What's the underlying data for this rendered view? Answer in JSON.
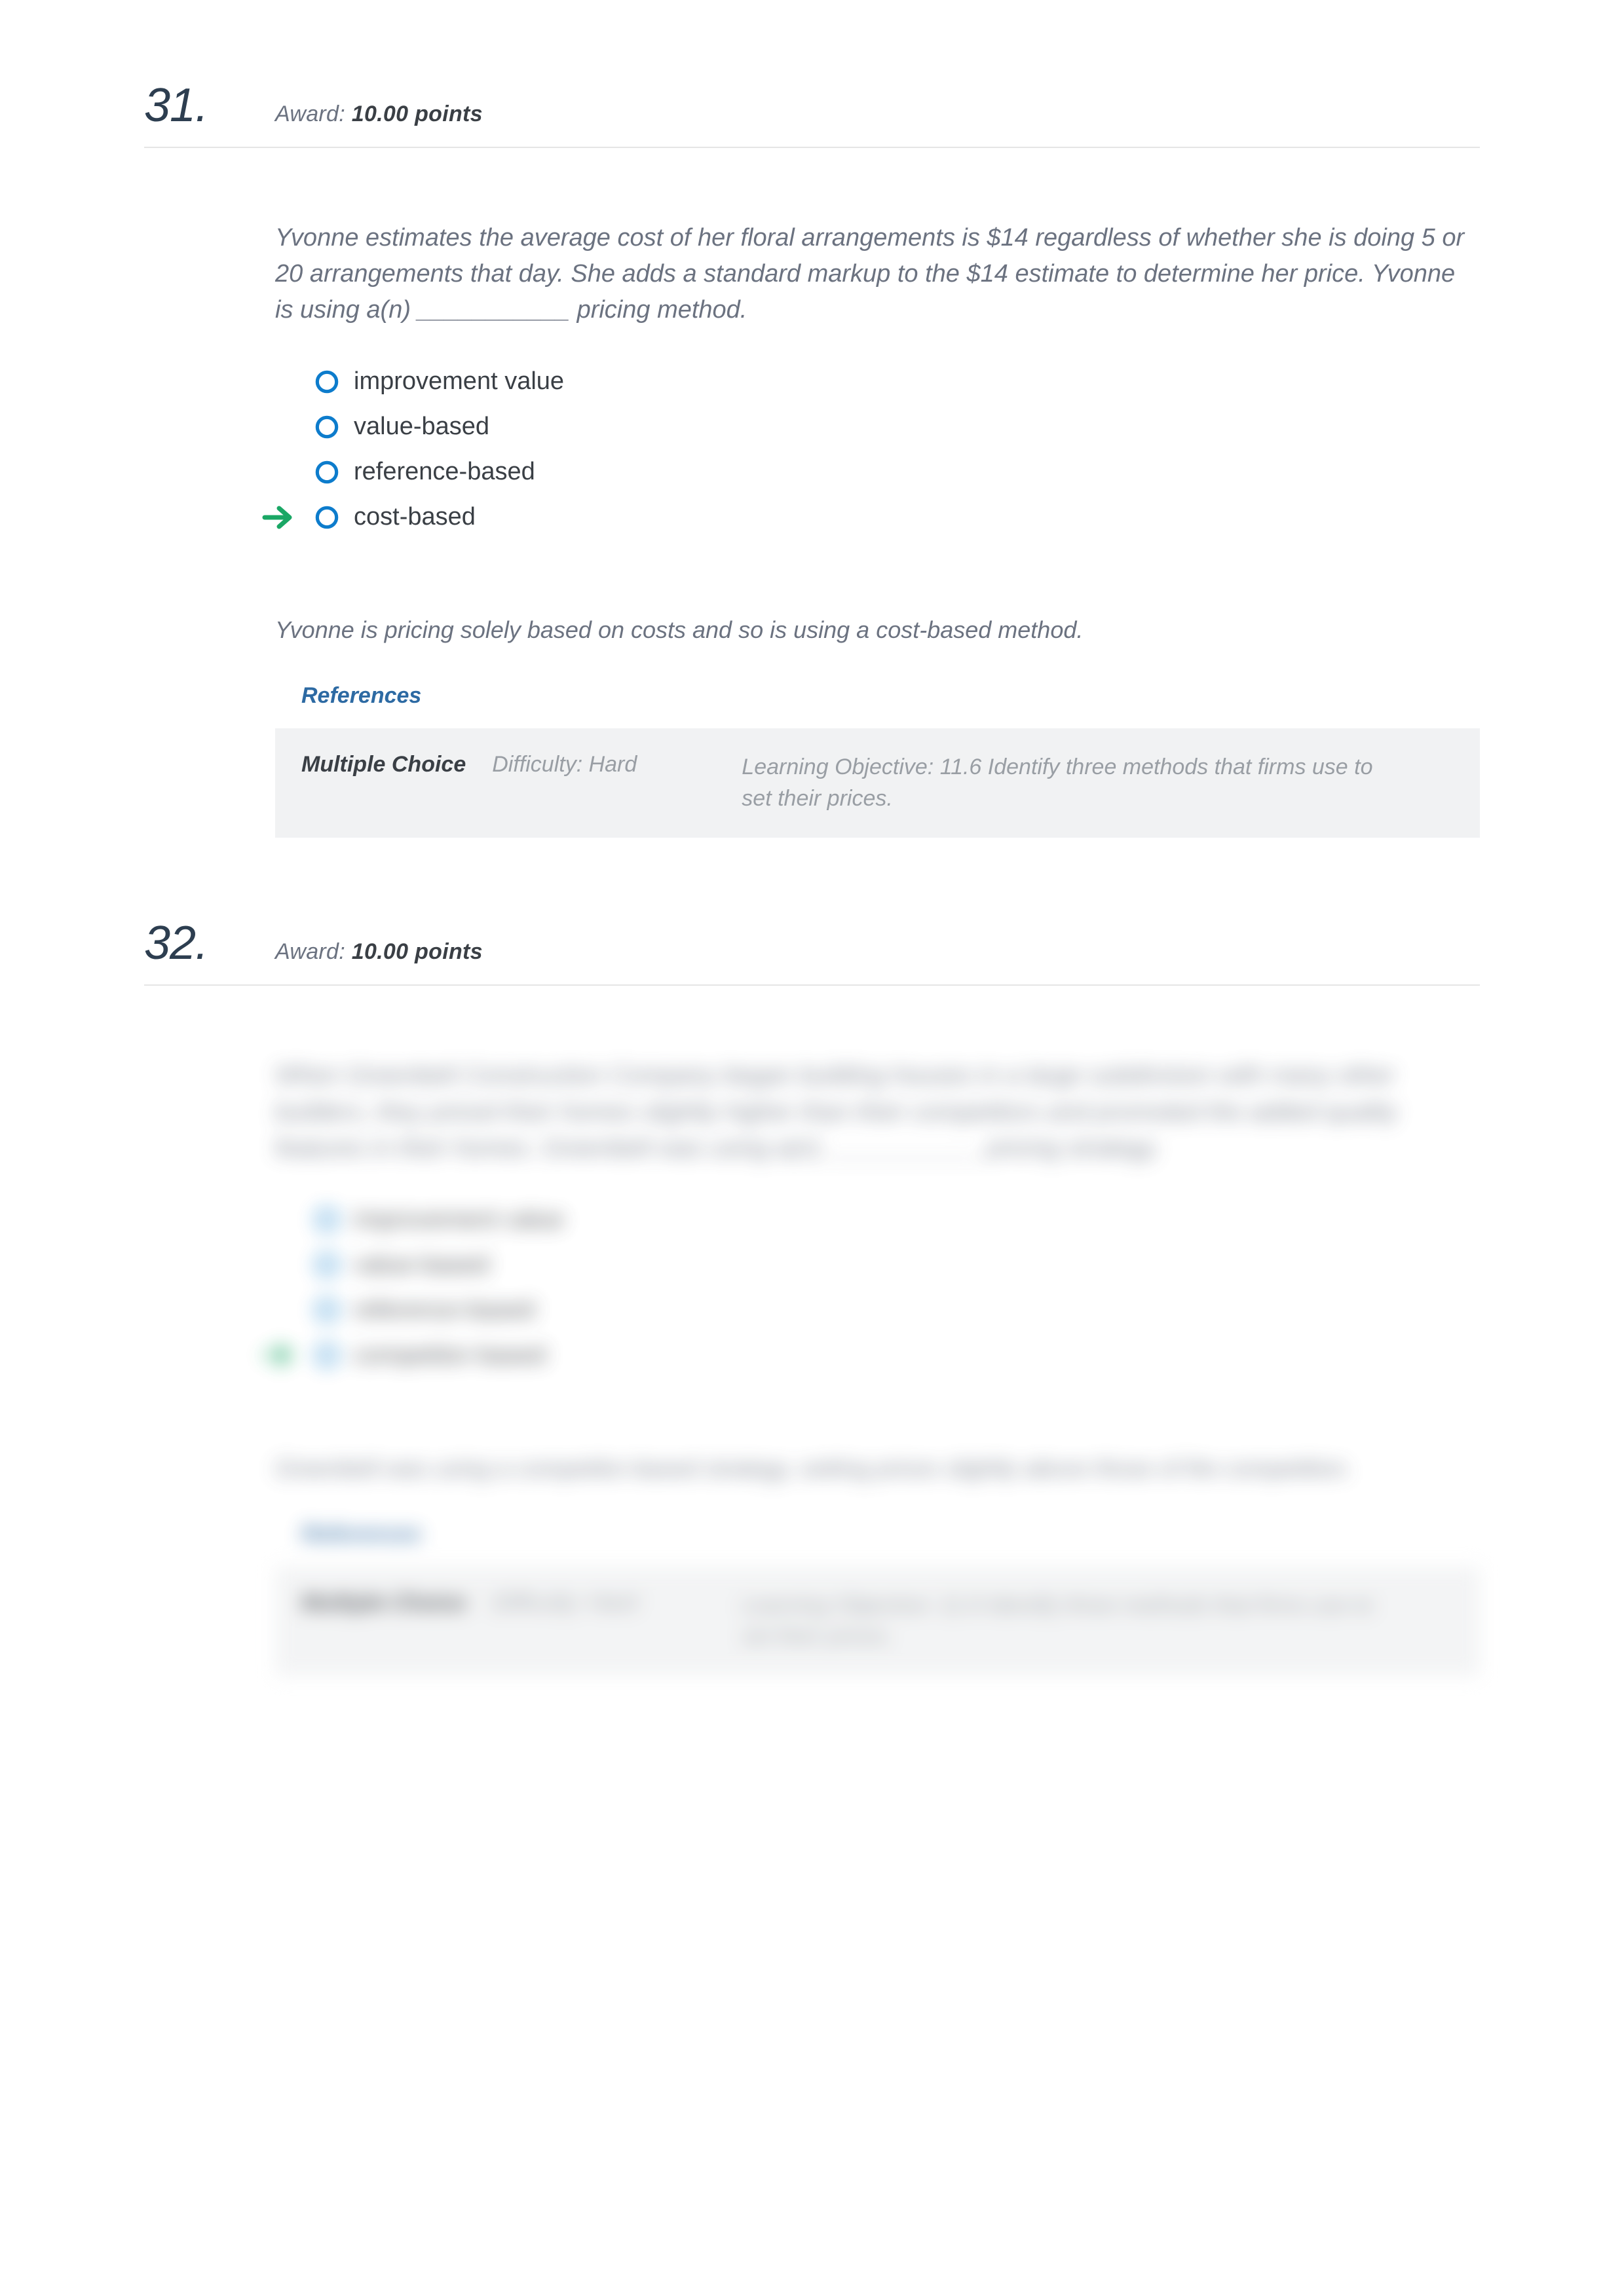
{
  "questions": [
    {
      "number": "31.",
      "award_prefix": "Award: ",
      "award_points": "10.00 points",
      "stem": "Yvonne estimates the average cost of her floral arrangements is $14 regardless of whether she is doing 5 or 20 arrangements that day. She adds a standard markup to the $14 estimate to determine her price. Yvonne is using a(n) ___________ pricing method.",
      "options": [
        {
          "label": "improvement value",
          "correct": false
        },
        {
          "label": "value-based",
          "correct": false
        },
        {
          "label": "reference-based",
          "correct": false
        },
        {
          "label": "cost-based",
          "correct": true
        }
      ],
      "explanation": "Yvonne is pricing solely based on costs and so is using a cost-based method.",
      "references_label": "References",
      "meta": {
        "type": "Multiple Choice",
        "difficulty": "Difficulty: Hard",
        "learning_objective": "Learning Objective: 11.6 Identify three methods that firms use to set their prices."
      },
      "blurred": false
    },
    {
      "number": "32.",
      "award_prefix": "Award: ",
      "award_points": "10.00 points",
      "stem": "When Greenbelt Construction Company began building houses in a large subdivision with many other builders, they priced their homes slightly higher than their competitors and promoted the added quality features in their homes. Greenbelt was using a(n) ___________ pricing strategy.",
      "options": [
        {
          "label": "improvement value",
          "correct": false
        },
        {
          "label": "value-based",
          "correct": false
        },
        {
          "label": "reference-based",
          "correct": false
        },
        {
          "label": "competitor-based",
          "correct": true
        }
      ],
      "explanation": "Greenbelt was using a competitor-based strategy, setting prices slightly above those of the competition.",
      "references_label": "References",
      "meta": {
        "type": "Multiple Choice",
        "difficulty": "Difficulty: Hard",
        "learning_objective": "Learning Objective: 11.6 Identify three methods that firms use to set their prices."
      },
      "blurred": true
    }
  ]
}
